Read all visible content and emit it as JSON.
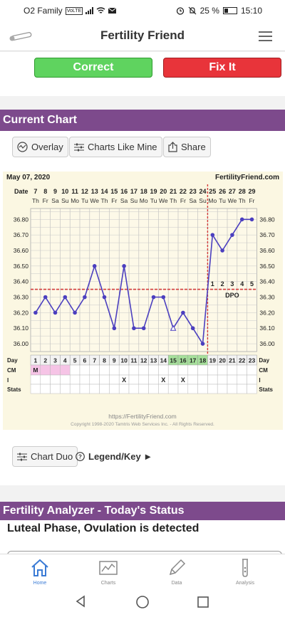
{
  "status_bar": {
    "carrier": "O2 Family",
    "volte": "VoLTE",
    "battery": "25 %",
    "time": "15:10"
  },
  "app": {
    "title": "Fertility Friend"
  },
  "actions": {
    "correct": "Correct",
    "fix": "Fix It"
  },
  "current_chart": {
    "header": "Current Chart",
    "overlay": "Overlay",
    "charts_like_mine": "Charts Like Mine",
    "share": "Share",
    "chart_duo": "Chart Duo",
    "legend_key": "Legend/Key ►"
  },
  "chart_data": {
    "type": "line",
    "date_label": "May 07, 2020",
    "brand": "FertilityFriend.com",
    "date_row_label": "Date",
    "dates": [
      "7",
      "8",
      "9",
      "10",
      "11",
      "12",
      "13",
      "14",
      "15",
      "16",
      "17",
      "18",
      "19",
      "20",
      "21",
      "22",
      "23",
      "24",
      "25",
      "26",
      "27",
      "28",
      "29"
    ],
    "weekdays": [
      "Th",
      "Fr",
      "Sa",
      "Su",
      "Mo",
      "Tu",
      "We",
      "Th",
      "Fr",
      "Sa",
      "Su",
      "Mo",
      "Tu",
      "We",
      "Th",
      "Fr",
      "Sa",
      "Su",
      "Mo",
      "Tu",
      "We",
      "Th",
      "Fr"
    ],
    "days": [
      "1",
      "2",
      "3",
      "4",
      "5",
      "6",
      "7",
      "8",
      "9",
      "10",
      "11",
      "12",
      "13",
      "14",
      "15",
      "16",
      "17",
      "18",
      "19",
      "20",
      "21",
      "22",
      "23"
    ],
    "temps": [
      36.2,
      36.3,
      36.2,
      36.3,
      36.2,
      36.3,
      36.5,
      36.3,
      36.1,
      36.5,
      36.1,
      36.1,
      36.3,
      36.3,
      36.1,
      36.2,
      36.1,
      36.0,
      36.7,
      36.6,
      36.7,
      36.8,
      36.8
    ],
    "open_point_day": 15,
    "y_ticks": [
      "36.80",
      "36.70",
      "36.60",
      "36.50",
      "36.40",
      "36.30",
      "36.20",
      "36.10",
      "36.00"
    ],
    "ylim": [
      35.95,
      36.87
    ],
    "coverline": 36.35,
    "ovulation_day": 18,
    "fertile_days": [
      15,
      16,
      17
    ],
    "dpo_numbers": [
      "1",
      "2",
      "3",
      "4",
      "5"
    ],
    "dpo_label": "DPO",
    "row_labels": {
      "day": "Day",
      "cm": "CM",
      "i": "I",
      "stats": "Stats"
    },
    "cm_entries": [
      {
        "day": 1,
        "value": "M"
      }
    ],
    "cm_shaded_days": [
      1,
      2,
      3,
      4
    ],
    "intercourse_days": [
      10,
      14,
      16
    ],
    "intercourse_mark": "X",
    "url": "https://FertilityFriend.com",
    "copyright": "Copyright 1998-2020 Tamtris Web Services Inc. - All Rights Reserved."
  },
  "analyzer": {
    "header": "Fertility Analyzer - Today's Status",
    "status": "Luteal Phase, Ovulation is detected"
  },
  "bottom_nav": [
    {
      "label": "Home",
      "icon": "home-icon",
      "active": true
    },
    {
      "label": "Charts",
      "icon": "chart-icon",
      "active": false
    },
    {
      "label": "Data",
      "icon": "pencil-icon",
      "active": false
    },
    {
      "label": "Analysis",
      "icon": "test-tube-icon",
      "active": false
    }
  ],
  "colors": {
    "purple": "#7d4a8c",
    "correct": "#5fd35f",
    "fix": "#e8343a",
    "line": "#4b3fbf",
    "coverline": "#d33b3b",
    "fertile": "#a6e09b",
    "cm": "#f6c4e6"
  }
}
